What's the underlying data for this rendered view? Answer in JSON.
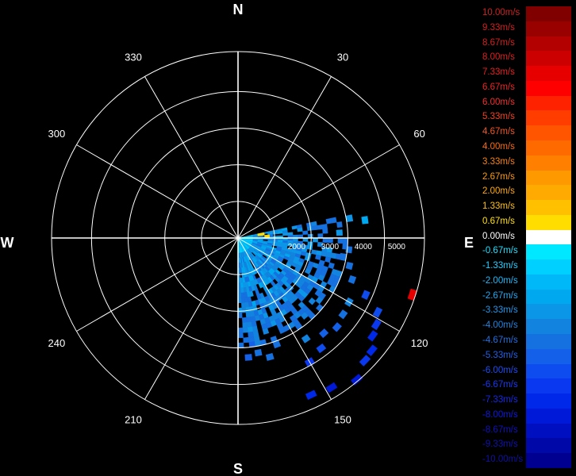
{
  "chart_data": {
    "type": "polar-heatmap",
    "cardinals": {
      "n": "N",
      "e": "E",
      "s": "S",
      "w": "W"
    },
    "azimuth_labels": [
      {
        "angle": 30,
        "text": "30"
      },
      {
        "angle": 60,
        "text": "60"
      },
      {
        "angle": 120,
        "text": "120"
      },
      {
        "angle": 150,
        "text": "150"
      },
      {
        "angle": 210,
        "text": "210"
      },
      {
        "angle": 240,
        "text": "240"
      },
      {
        "angle": 300,
        "text": "300"
      },
      {
        "angle": 330,
        "text": "330"
      }
    ],
    "range_labels": [
      {
        "value": 2000,
        "text": "2000"
      },
      {
        "value": 3000,
        "text": "3000"
      },
      {
        "value": 4000,
        "text": "4000"
      },
      {
        "value": 5000,
        "text": "5000"
      }
    ],
    "range_max": 5600,
    "ring_ranges": [
      1100,
      2200,
      3300,
      4400,
      5600
    ],
    "spoke_step_deg": 30,
    "data_sector": {
      "az_start": 78,
      "az_end": 180,
      "range_min": 0,
      "range_max": 3300
    },
    "scatter_cells": [
      {
        "az": 80,
        "r": 3400,
        "v": -3.5
      },
      {
        "az": 82,
        "r": 3850,
        "v": -3.0
      },
      {
        "az": 87,
        "r": 3050,
        "v": -3.3
      },
      {
        "az": 96,
        "r": 3350,
        "v": -4.5
      },
      {
        "az": 100,
        "r": 3200,
        "v": -4.5
      },
      {
        "az": 104,
        "r": 3450,
        "v": -5.0
      },
      {
        "az": 110,
        "r": 3650,
        "v": -4.5
      },
      {
        "az": 114,
        "r": 4200,
        "v": -6.0
      },
      {
        "az": 108,
        "r": 5500,
        "v": 7.0
      },
      {
        "az": 118,
        "r": 4750,
        "v": -6.0
      },
      {
        "az": 122,
        "r": 4900,
        "v": -6.7
      },
      {
        "az": 126,
        "r": 5000,
        "v": -7.3
      },
      {
        "az": 130,
        "r": 5250,
        "v": -7.3
      },
      {
        "az": 134,
        "r": 5300,
        "v": -6.7
      },
      {
        "az": 120,
        "r": 3850,
        "v": -4.0
      },
      {
        "az": 126,
        "r": 3900,
        "v": -4.7
      },
      {
        "az": 132,
        "r": 4000,
        "v": -5.3
      },
      {
        "az": 138,
        "r": 3850,
        "v": -5.3
      },
      {
        "az": 143,
        "r": 4150,
        "v": -6.0
      },
      {
        "az": 146,
        "r": 3650,
        "v": -4.0
      },
      {
        "az": 150,
        "r": 4300,
        "v": -6.7
      },
      {
        "az": 148,
        "r": 5300,
        "v": -8.0
      },
      {
        "az": 140,
        "r": 5550,
        "v": -8.0
      },
      {
        "az": 155,
        "r": 5200,
        "v": -7.3
      },
      {
        "az": 160,
        "r": 3400,
        "v": -4.5
      },
      {
        "az": 165,
        "r": 3700,
        "v": -5.0
      },
      {
        "az": 170,
        "r": 3500,
        "v": -4.5
      },
      {
        "az": 175,
        "r": 3600,
        "v": -5.5
      }
    ],
    "color_scale": [
      {
        "label": "10.00m/s",
        "value": 10.0,
        "color": "#800000",
        "text_color": "#cc2222"
      },
      {
        "label": "9.33m/s",
        "value": 9.33,
        "color": "#990000",
        "text_color": "#d02020"
      },
      {
        "label": "8.67m/s",
        "value": 8.67,
        "color": "#b30000",
        "text_color": "#d62020"
      },
      {
        "label": "8.00m/s",
        "value": 8.0,
        "color": "#cc0000",
        "text_color": "#dd2020"
      },
      {
        "label": "7.33m/s",
        "value": 7.33,
        "color": "#e60000",
        "text_color": "#e32020"
      },
      {
        "label": "6.67m/s",
        "value": 6.67,
        "color": "#ff0000",
        "text_color": "#ee2525"
      },
      {
        "label": "6.00m/s",
        "value": 6.0,
        "color": "#ff2200",
        "text_color": "#f03030"
      },
      {
        "label": "5.33m/s",
        "value": 5.33,
        "color": "#ff3d00",
        "text_color": "#f24020"
      },
      {
        "label": "4.67m/s",
        "value": 4.67,
        "color": "#ff5500",
        "text_color": "#f55520"
      },
      {
        "label": "4.00m/s",
        "value": 4.0,
        "color": "#ff6a00",
        "text_color": "#f86a10"
      },
      {
        "label": "3.33m/s",
        "value": 3.33,
        "color": "#ff8000",
        "text_color": "#fa8010"
      },
      {
        "label": "2.67m/s",
        "value": 2.67,
        "color": "#ff9900",
        "text_color": "#fc9a10"
      },
      {
        "label": "2.00m/s",
        "value": 2.0,
        "color": "#ffaa00",
        "text_color": "#fdaa10"
      },
      {
        "label": "1.33m/s",
        "value": 1.33,
        "color": "#ffc000",
        "text_color": "#fec010"
      },
      {
        "label": "0.67m/s",
        "value": 0.67,
        "color": "#ffdd00",
        "text_color": "#ffe010"
      },
      {
        "label": "0.00m/s",
        "value": 0.0,
        "color": "#ffffff",
        "text_color": "#ffffff"
      },
      {
        "label": "-0.67m/s",
        "value": -0.67,
        "color": "#00e8ff",
        "text_color": "#20e0ff"
      },
      {
        "label": "-1.33m/s",
        "value": -1.33,
        "color": "#00d0ff",
        "text_color": "#20d0ff"
      },
      {
        "label": "-2.00m/s",
        "value": -2.0,
        "color": "#00b8f8",
        "text_color": "#20b8f8"
      },
      {
        "label": "-2.67m/s",
        "value": -2.67,
        "color": "#00a8f0",
        "text_color": "#20a8f0"
      },
      {
        "label": "-3.33m/s",
        "value": -3.33,
        "color": "#0c96e8",
        "text_color": "#2096e8"
      },
      {
        "label": "-4.00m/s",
        "value": -4.0,
        "color": "#1284e0",
        "text_color": "#2084e0"
      },
      {
        "label": "-4.67m/s",
        "value": -4.67,
        "color": "#1570e0",
        "text_color": "#2070e0"
      },
      {
        "label": "-5.33m/s",
        "value": -5.33,
        "color": "#1460e8",
        "text_color": "#2060e8"
      },
      {
        "label": "-6.00m/s",
        "value": -6.0,
        "color": "#0f4cf0",
        "text_color": "#1e4cf0"
      },
      {
        "label": "-6.67m/s",
        "value": -6.67,
        "color": "#0a38f0",
        "text_color": "#1a38f0"
      },
      {
        "label": "-7.33m/s",
        "value": -7.33,
        "color": "#0028e8",
        "text_color": "#1528e8"
      },
      {
        "label": "-8.00m/s",
        "value": -8.0,
        "color": "#0018d8",
        "text_color": "#1018d8"
      },
      {
        "label": "-8.67m/s",
        "value": -8.67,
        "color": "#0010c0",
        "text_color": "#1010c0"
      },
      {
        "label": "-9.33m/s",
        "value": -9.33,
        "color": "#0008a8",
        "text_color": "#1010b0"
      },
      {
        "label": "-10.00m/s",
        "value": -10.0,
        "color": "#000090",
        "text_color": "#1010a0"
      }
    ]
  }
}
